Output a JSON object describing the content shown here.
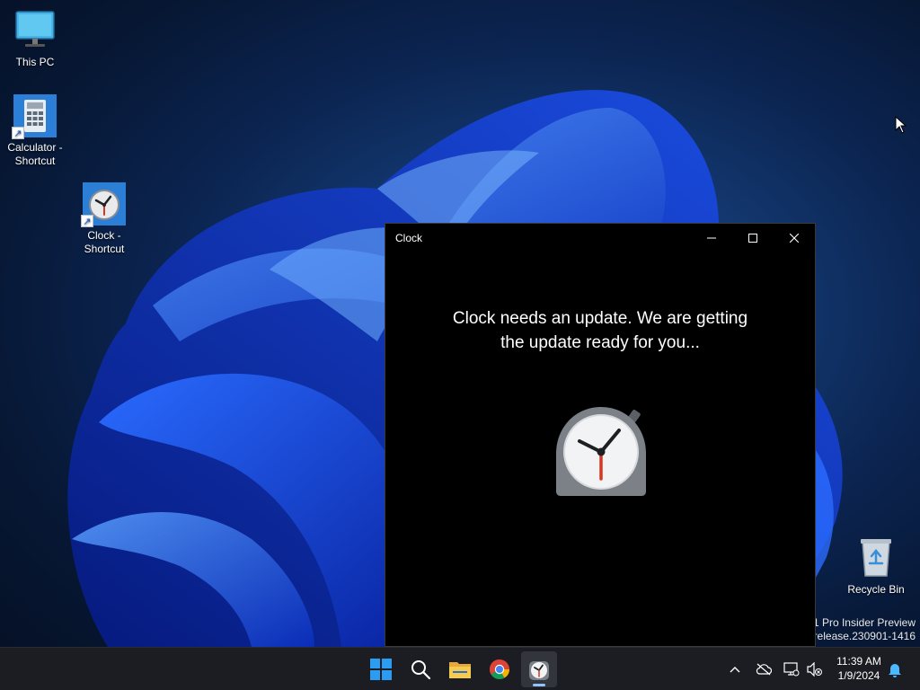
{
  "desktop": {
    "icons": [
      {
        "label_1": "This PC",
        "label_2": ""
      },
      {
        "label_1": "Calculator -",
        "label_2": "Shortcut"
      },
      {
        "label_1": "Clock -",
        "label_2": "Shortcut"
      },
      {
        "label_1": "Recycle Bin",
        "label_2": ""
      }
    ],
    "shortcut_arrow_glyph": "↗"
  },
  "window": {
    "title": "Clock",
    "message_line_1": "Clock needs an update. We are getting",
    "message_line_2": "the update ready for you...",
    "controls": [
      "minimize",
      "maximize",
      "close"
    ]
  },
  "watermark": {
    "line_1": "1 Pro Insider Preview",
    "line_2": "erelease.230901-1416"
  },
  "taskbar": {
    "apps": [
      "start-icon",
      "search-icon",
      "file-explorer-icon",
      "chrome-icon",
      "clock-icon"
    ],
    "active_app": "clock-icon",
    "tray": {
      "time": "11:39 AM",
      "date": "1/9/2024",
      "icons": [
        "chevron-up-icon",
        "cloud-offline-icon",
        "network-icon",
        "volume-muted-icon",
        "notification-bell-icon"
      ]
    }
  },
  "colors": {
    "window_bg": "#000000",
    "taskbar_bg": "#1c1d22",
    "accent": "#0078d4",
    "clock_hand_red": "#d5381f"
  }
}
